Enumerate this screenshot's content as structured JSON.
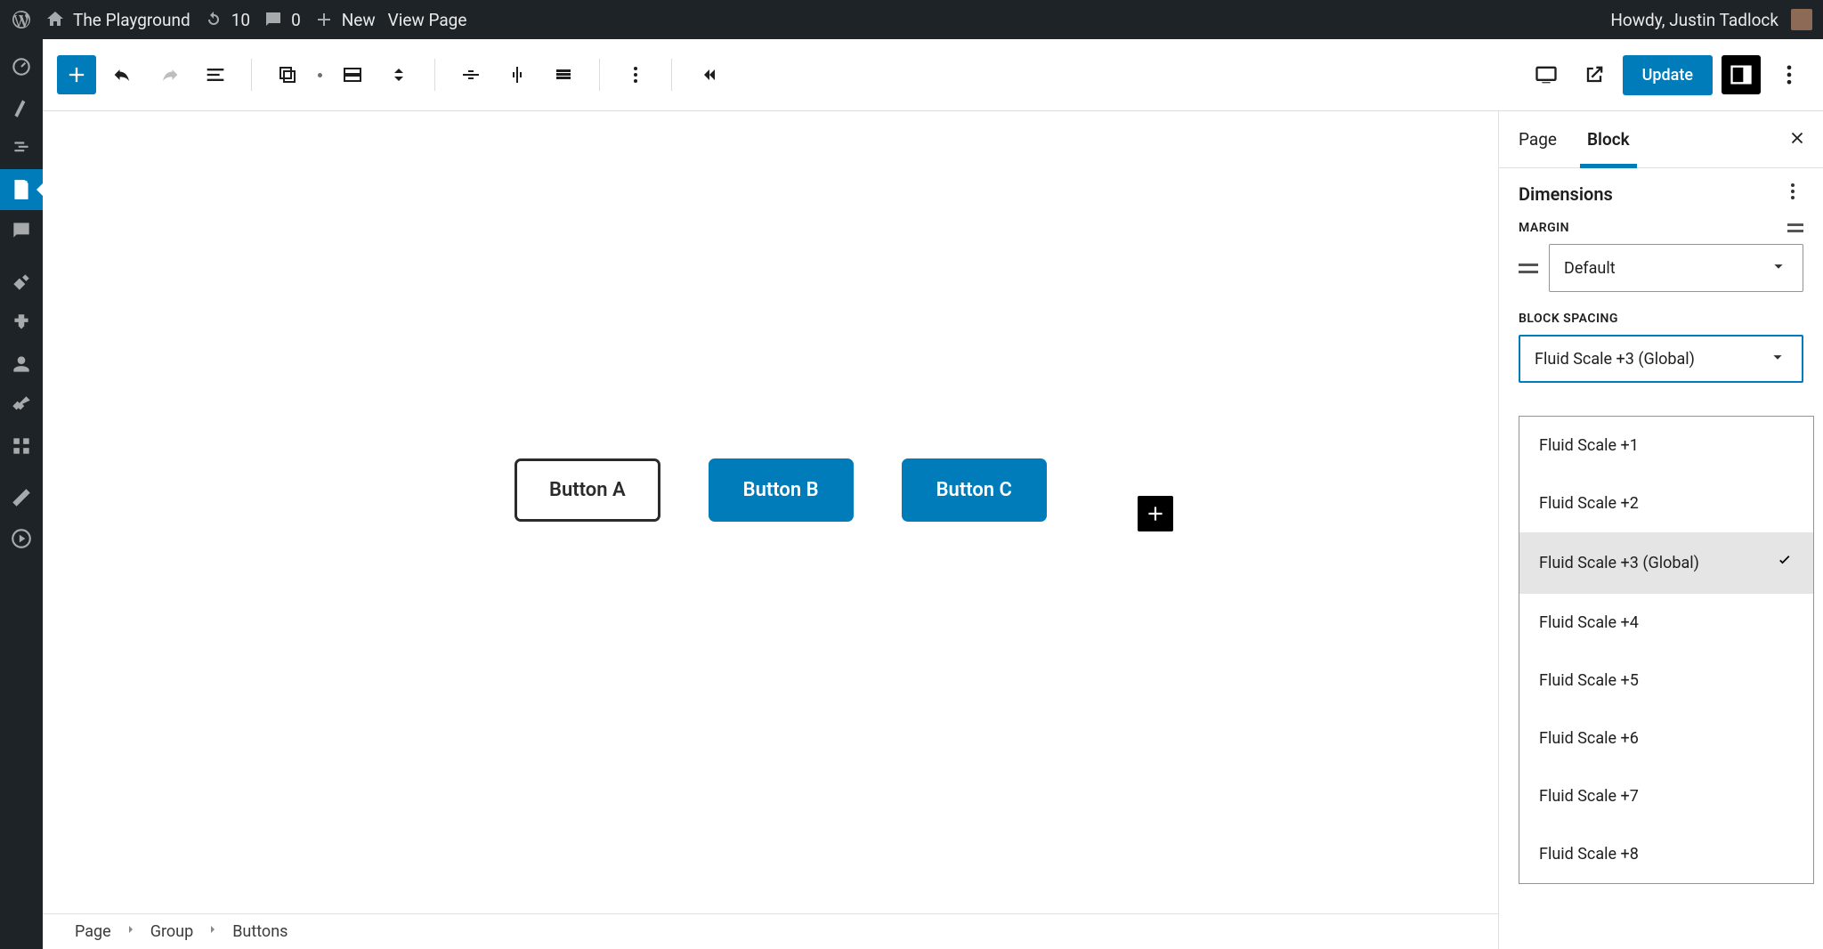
{
  "adminbar": {
    "site_name": "The Playground",
    "updates_count": "10",
    "comments_count": "0",
    "new_label": "New",
    "view_page_label": "View Page",
    "greeting": "Howdy, Justin Tadlock"
  },
  "wp_sidebar": [
    {
      "name": "dashboard-icon"
    },
    {
      "name": "pin-icon"
    },
    {
      "name": "media-icon"
    },
    {
      "name": "pages-icon",
      "active": true
    },
    {
      "name": "comments-icon"
    },
    {
      "name": "plugins-icon"
    },
    {
      "name": "appearance-icon"
    },
    {
      "name": "users-icon"
    },
    {
      "name": "tools-icon"
    },
    {
      "name": "settings-grid-icon"
    },
    {
      "name": "edit-icon"
    },
    {
      "name": "toggle-icon"
    }
  ],
  "header": {
    "update_label": "Update"
  },
  "tabs": {
    "page": "Page",
    "block": "Block",
    "active": "block"
  },
  "panel": {
    "title": "Dimensions",
    "margin_label": "MARGIN",
    "margin_value": "Default",
    "block_spacing_label": "BLOCK SPACING",
    "block_spacing_value": "Fluid Scale +3 (Global)",
    "options": [
      {
        "label": "Fluid Scale +1",
        "selected": false
      },
      {
        "label": "Fluid Scale +2",
        "selected": false
      },
      {
        "label": "Fluid Scale +3 (Global)",
        "selected": true
      },
      {
        "label": "Fluid Scale +4",
        "selected": false
      },
      {
        "label": "Fluid Scale +5",
        "selected": false
      },
      {
        "label": "Fluid Scale +6",
        "selected": false
      },
      {
        "label": "Fluid Scale +7",
        "selected": false
      },
      {
        "label": "Fluid Scale +8",
        "selected": false
      }
    ]
  },
  "canvas": {
    "buttons": [
      "Button A",
      "Button B",
      "Button C"
    ]
  },
  "breadcrumbs": [
    "Page",
    "Group",
    "Buttons"
  ]
}
